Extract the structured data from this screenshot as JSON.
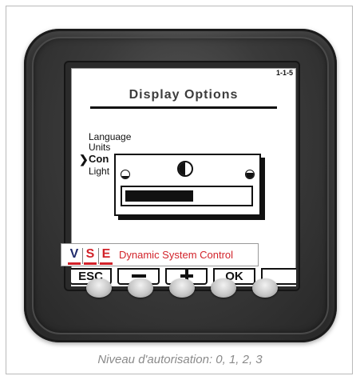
{
  "screen": {
    "code": "1-1-5",
    "title": "Display Options",
    "menu": [
      {
        "label": "Language",
        "selected": false
      },
      {
        "label": "Units",
        "selected": false
      },
      {
        "label": "Con",
        "selected": true
      },
      {
        "label": "Light",
        "selected": false
      }
    ],
    "cursor": "❯",
    "contrast_dialog": {
      "icon": "contrast-icon",
      "min_icon": "contrast-min-icon",
      "max_icon": "contrast-max-icon",
      "level_fraction": 0.55
    },
    "softkeys": [
      {
        "label": "ESC",
        "icon": null
      },
      {
        "label": "",
        "icon": "minus-icon"
      },
      {
        "label": "",
        "icon": "plus-icon"
      },
      {
        "label": "OK",
        "icon": null
      },
      {
        "label": "",
        "icon": null
      }
    ]
  },
  "brand": {
    "logo_letters": [
      "V",
      "S",
      "E"
    ],
    "text": "Dynamic System Control",
    "colors": {
      "blue": "#1f2a6b",
      "red": "#d2232a"
    }
  },
  "hardware_buttons": 5,
  "caption": "Niveau d'autorisation: 0, 1, 2, 3"
}
